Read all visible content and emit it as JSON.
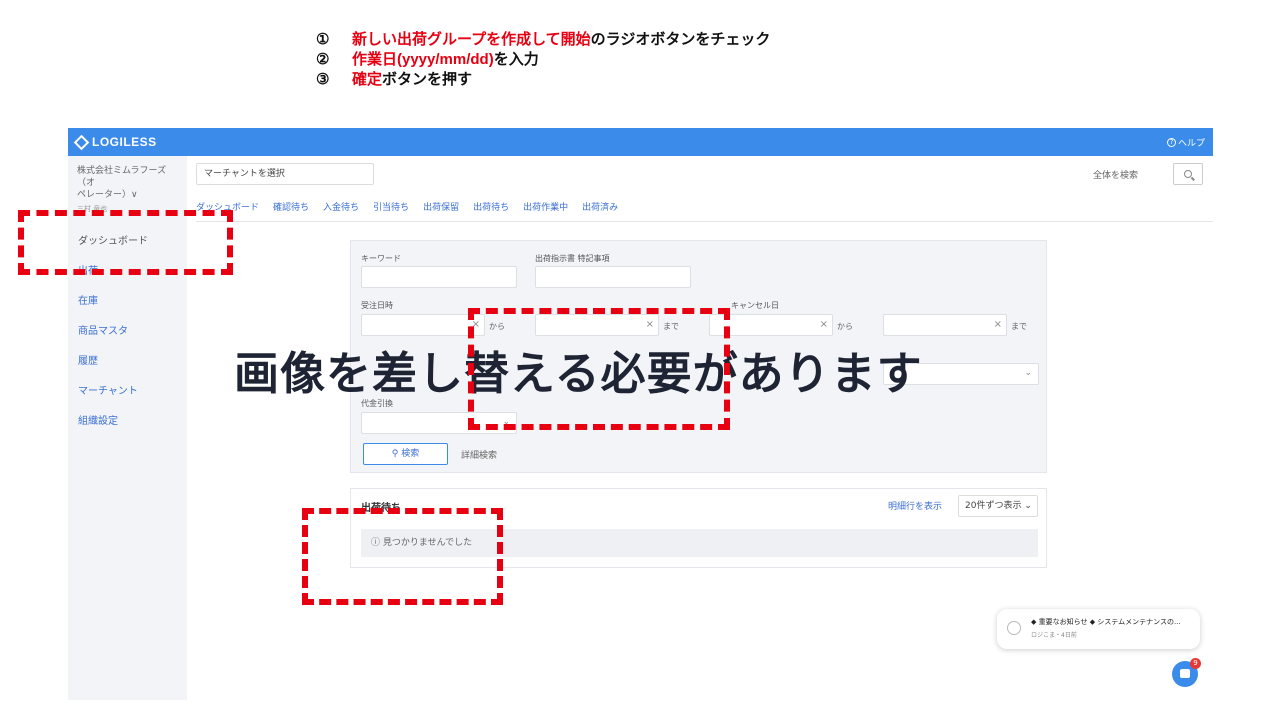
{
  "instructions": [
    {
      "num": "①",
      "highlight": "新しい出荷グループを作成して開始",
      "rest": "のラジオボタンをチェック"
    },
    {
      "num": "②",
      "highlight": "作業日(yyyy/mm/dd)",
      "rest": "を入力"
    },
    {
      "num": "③",
      "highlight": "確定",
      "rest": "ボタンを押す"
    }
  ],
  "app": {
    "logo": "LOGILESS",
    "help": "ヘルプ",
    "org_name_line1": "株式会社ミムラフーズ（オ",
    "org_name_line2": "ペレーター）∨",
    "org_user": "三村 竜也",
    "sidebar": [
      "ダッシュボード",
      "出荷",
      "在庫",
      "商品マスタ",
      "履歴",
      "マーチャント",
      "組織設定"
    ],
    "merchant_select": "マーチャントを選択",
    "global_search_label": "全体を検索",
    "tabs": [
      "ダッシュボード",
      "確認待ち",
      "入金待ち",
      "引当待ち",
      "出荷保留",
      "出荷待ち",
      "出荷作業中",
      "出荷済み"
    ],
    "filters": {
      "keyword_label": "キーワード",
      "instruction_note_label": "出荷指示書 特記事項",
      "order_date_label": "受注日時",
      "cancel_date_label": "キャンセル日",
      "from": "から",
      "to": "まで",
      "cod_label": "代金引換",
      "search_button": "検索",
      "advanced_search": "詳細検索"
    },
    "results": {
      "title": "出荷待ち",
      "show_rows": "明細行を表示",
      "per_page": "20件ずつ表示",
      "empty": "見つかりませんでした"
    },
    "notification": {
      "title": "◆ 重要なお知らせ ◆ システムメンテナンスの...",
      "meta": "ロジこま・4日前",
      "badge": "9"
    }
  },
  "overlay_text": "画像を差し替える必要があります",
  "colors": {
    "accent": "#3b8bea",
    "highlight_red": "#e60012",
    "sidebar_bg": "#f2f4f7"
  }
}
